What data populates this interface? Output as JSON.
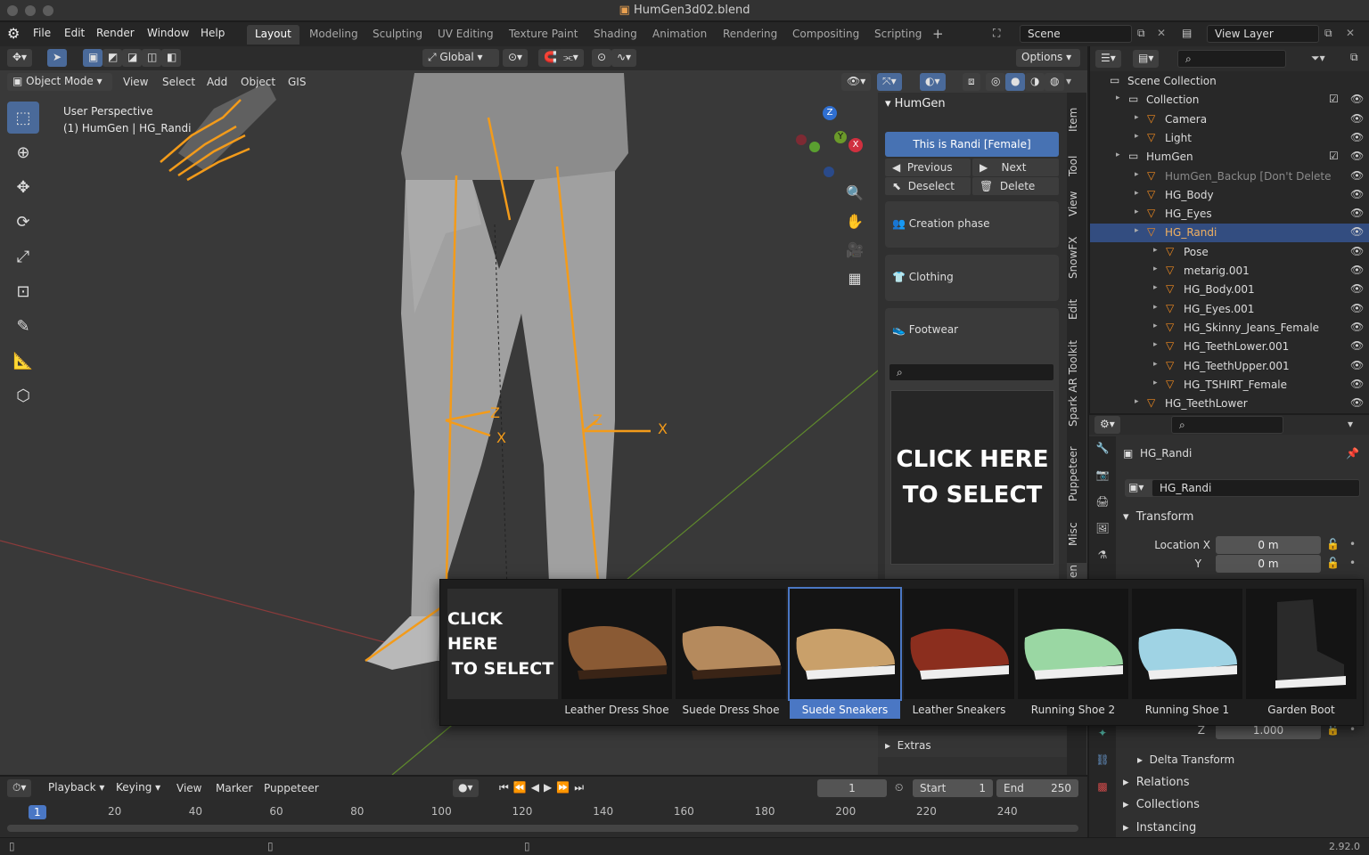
{
  "window": {
    "title": "HumGen3d02.blend"
  },
  "menu": [
    "File",
    "Edit",
    "Render",
    "Window",
    "Help"
  ],
  "workspaces": [
    "Layout",
    "Modeling",
    "Sculpting",
    "UV Editing",
    "Texture Paint",
    "Shading",
    "Animation",
    "Rendering",
    "Compositing",
    "Scripting"
  ],
  "scene": {
    "label": "Scene",
    "view_layer": "View Layer"
  },
  "viewport": {
    "mode": "Object Mode",
    "menus": [
      "View",
      "Select",
      "Add",
      "Object",
      "GIS"
    ],
    "transform": "Global",
    "options": "Options",
    "info1": "User Perspective",
    "info2": "(1) HumGen | HG_Randi",
    "gizmo_x": "X",
    "gizmo_y": "Y",
    "gizmo_z": "Z",
    "bone_x": "X",
    "bone_z": "Z"
  },
  "humgen": {
    "panel_title": "HumGen",
    "selected_label": "This is Randi [Female]",
    "previous": "Previous",
    "next": "Next",
    "deselect": "Deselect",
    "delete": "Delete",
    "creation_phase": "Creation phase",
    "clothing": "Clothing",
    "footwear": "Footwear",
    "preview_text1": "CLICK HERE",
    "preview_text2": "TO SELECT",
    "extras": "Extras"
  },
  "side_tabs": [
    "Item",
    "Tool",
    "View",
    "SnowFX",
    "Edit",
    "Spark AR Toolkit",
    "Puppeteer",
    "Misc",
    "en"
  ],
  "outliner": [
    {
      "name": "Scene Collection",
      "indent": 0
    },
    {
      "name": "Collection",
      "indent": 1,
      "check": true
    },
    {
      "name": "Camera",
      "indent": 2
    },
    {
      "name": "Light",
      "indent": 2
    },
    {
      "name": "HumGen",
      "indent": 1,
      "check": true
    },
    {
      "name": "HumGen_Backup [Don't Delete",
      "indent": 2,
      "dim": true
    },
    {
      "name": "HG_Body",
      "indent": 2
    },
    {
      "name": "HG_Eyes",
      "indent": 2
    },
    {
      "name": "HG_Randi",
      "indent": 2,
      "selected": true
    },
    {
      "name": "Pose",
      "indent": 3
    },
    {
      "name": "metarig.001",
      "indent": 3
    },
    {
      "name": "HG_Body.001",
      "indent": 3
    },
    {
      "name": "HG_Eyes.001",
      "indent": 3
    },
    {
      "name": "HG_Skinny_Jeans_Female",
      "indent": 3
    },
    {
      "name": "HG_TeethLower.001",
      "indent": 3
    },
    {
      "name": "HG_TeethUpper.001",
      "indent": 3
    },
    {
      "name": "HG_TSHIRT_Female",
      "indent": 3
    },
    {
      "name": "HG_TeethLower",
      "indent": 2
    }
  ],
  "properties": {
    "object_name": "HG_Randi",
    "data_name": "HG_Randi",
    "transform": "Transform",
    "loc_x_label": "Location X",
    "loc_x": "0 m",
    "loc_y_label": "Y",
    "loc_y": "0 m",
    "scale_z_label": "Z",
    "scale_z": "1.000",
    "delta": "Delta Transform",
    "relations": "Relations",
    "collections": "Collections",
    "instancing": "Instancing"
  },
  "footwear_popup": {
    "items": [
      {
        "label": "",
        "kind": "select"
      },
      {
        "label": "Leather Dress Shoe",
        "kind": "dress",
        "color": "#8a5a34"
      },
      {
        "label": "Suede Dress Shoe",
        "kind": "dress",
        "color": "#b58a5d"
      },
      {
        "label": "Suede Sneakers",
        "kind": "sneaker",
        "color": "#c9a06a",
        "selected": true
      },
      {
        "label": "Leather Sneakers",
        "kind": "sneaker",
        "color": "#8b2e1e"
      },
      {
        "label": "Running Shoe 2",
        "kind": "runner",
        "color": "#9ad7a3"
      },
      {
        "label": "Running Shoe 1",
        "kind": "runner",
        "color": "#9fd3e4"
      },
      {
        "label": "Garden Boot",
        "kind": "boot",
        "color": "#2a2a2a"
      }
    ]
  },
  "timeline": {
    "menus": [
      "Playback",
      "Keying",
      "View",
      "Marker",
      "Puppeteer"
    ],
    "current_frame": "1",
    "start_label": "Start",
    "start": "1",
    "end_label": "End",
    "end": "250",
    "ticks": [
      "1",
      "20",
      "40",
      "60",
      "80",
      "100",
      "120",
      "140",
      "160",
      "180",
      "200",
      "220",
      "240"
    ]
  },
  "status": {
    "version": "2.92.0"
  }
}
